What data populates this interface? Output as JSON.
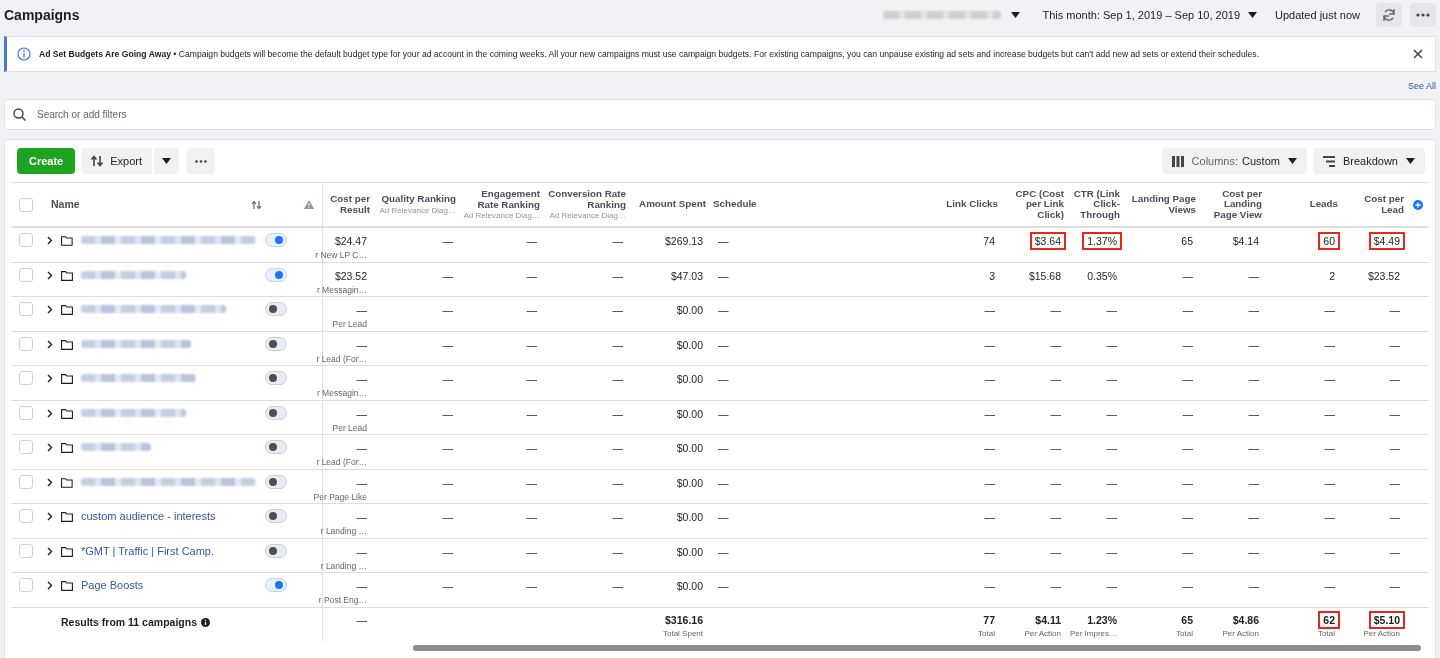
{
  "header": {
    "title": "Campaigns",
    "account": {
      "kind": "redacted"
    },
    "date_range": "This month: Sep 1, 2019 – Sep 10, 2019",
    "updated": "Updated just now"
  },
  "banner": {
    "text": "**Ad Set Budgets Are Going Away** • Campaign budgets will become the default budget type for your ad account in the coming weeks. All your new campaigns must use campaign budgets. For existing campaigns, you can unpause existing ad sets and increase budgets but can't add new ad sets or extend their schedules."
  },
  "see_all": "See All",
  "search": {
    "placeholder": "Search or add filters"
  },
  "toolbar": {
    "create": "Create",
    "export": "Export",
    "columns_label": "Columns:",
    "columns_value": "Custom",
    "breakdown": "Breakdown"
  },
  "table": {
    "name_column": "Name",
    "columns": [
      {
        "label": "Cost per Result"
      },
      {
        "label": "Quality Ranking",
        "sublabel": "Ad Relevance Diag…"
      },
      {
        "label": "Engagement Rate Ranking",
        "sublabel": "Ad Relevance Diag…"
      },
      {
        "label": "Conversion Rate Ranking",
        "sublabel": "Ad Relevance Diag…"
      },
      {
        "label": "Amount Spent"
      },
      {
        "label": "Schedule"
      },
      {
        "label": "Link Clicks"
      },
      {
        "label": "CPC (Cost per Link Click)"
      },
      {
        "label": "CTR (Link Click-Through"
      },
      {
        "label": "Landing Page Views"
      },
      {
        "label": "Cost per Landing Page View"
      },
      {
        "label": "Leads"
      },
      {
        "label": "Cost per Lead"
      }
    ],
    "select_all_checked": false,
    "rows": [
      {
        "name": null,
        "kind": "redacted",
        "checked": false,
        "on": true,
        "cells": [
          {
            "text": "$24.47",
            "sub": "r New LP C…"
          },
          "—",
          "—",
          "—",
          "$269.13",
          "—",
          "74",
          {
            "text": "$3.64",
            "marked": true
          },
          {
            "text": "1.37%",
            "marked": true
          },
          "65",
          "$4.14",
          {
            "text": "60",
            "marked": true
          },
          {
            "text": "$4.49",
            "marked": true
          }
        ]
      },
      {
        "name": null,
        "kind": "redacted",
        "checked": false,
        "on": true,
        "cells": [
          {
            "text": "$23.52",
            "sub": "r Messagin…"
          },
          "—",
          "—",
          "—",
          "$47.03",
          "—",
          "3",
          "$15.68",
          "0.35%",
          "—",
          "—",
          "2",
          "$23.52"
        ]
      },
      {
        "name": null,
        "kind": "redacted",
        "checked": false,
        "on": false,
        "cells": [
          {
            "text": "—",
            "sub": "Per Lead"
          },
          "—",
          "—",
          "—",
          "$0.00",
          "—",
          "—",
          "—",
          "—",
          "—",
          "—",
          "—",
          "—"
        ]
      },
      {
        "name": null,
        "kind": "redacted",
        "checked": false,
        "on": false,
        "cells": [
          {
            "text": "—",
            "sub": "r Lead (For…"
          },
          "—",
          "—",
          "—",
          "$0.00",
          "—",
          "—",
          "—",
          "—",
          "—",
          "—",
          "—",
          "—"
        ]
      },
      {
        "name": null,
        "kind": "redacted",
        "checked": false,
        "on": false,
        "cells": [
          {
            "text": "—",
            "sub": "r Messagin…"
          },
          "—",
          "—",
          "—",
          "$0.00",
          "—",
          "—",
          "—",
          "—",
          "—",
          "—",
          "—",
          "—"
        ]
      },
      {
        "name": null,
        "kind": "redacted",
        "checked": false,
        "on": false,
        "cells": [
          {
            "text": "—",
            "sub": "Per Lead"
          },
          "—",
          "—",
          "—",
          "$0.00",
          "—",
          "—",
          "—",
          "—",
          "—",
          "—",
          "—",
          "—"
        ]
      },
      {
        "name": null,
        "kind": "redacted",
        "checked": false,
        "on": false,
        "cells": [
          {
            "text": "—",
            "sub": "r Lead (For…"
          },
          "—",
          "—",
          "—",
          "$0.00",
          "—",
          "—",
          "—",
          "—",
          "—",
          "—",
          "—",
          "—"
        ]
      },
      {
        "name": null,
        "kind": "redacted",
        "checked": false,
        "on": false,
        "cells": [
          {
            "text": "—",
            "sub": "Per Page Like"
          },
          "—",
          "—",
          "—",
          "$0.00",
          "—",
          "—",
          "—",
          "—",
          "—",
          "—",
          "—",
          "—"
        ]
      },
      {
        "name": "custom audience - interests",
        "kind": "named",
        "checked": false,
        "on": false,
        "cells": [
          {
            "text": "—",
            "sub": "r Landing …"
          },
          "—",
          "—",
          "—",
          "$0.00",
          "—",
          "—",
          "—",
          "—",
          "—",
          "—",
          "—",
          "—"
        ]
      },
      {
        "name": "*GMT | Traffic | First Camp.",
        "kind": "named",
        "checked": false,
        "on": false,
        "cells": [
          {
            "text": "—",
            "sub": "r Landing …"
          },
          "—",
          "—",
          "—",
          "$0.00",
          "—",
          "—",
          "—",
          "—",
          "—",
          "—",
          "—",
          "—"
        ]
      },
      {
        "name": "Page Boosts",
        "kind": "named",
        "checked": false,
        "on": true,
        "cells": [
          {
            "text": "—",
            "sub": "r Post Eng…"
          },
          "—",
          "—",
          "—",
          "$0.00",
          "—",
          "—",
          "—",
          "—",
          "—",
          "—",
          "—",
          "—"
        ]
      }
    ],
    "totals": {
      "label": "Results from 11 campaigns",
      "cells": [
        "—",
        null,
        null,
        null,
        {
          "text": "$316.16",
          "sub": "Total Spent"
        },
        null,
        {
          "text": "77",
          "sub": "Total"
        },
        {
          "text": "$4.11",
          "sub": "Per Action"
        },
        {
          "text": "1.23%",
          "sub": "Per Impres…"
        },
        {
          "text": "65",
          "sub": "Total"
        },
        {
          "text": "$4.86",
          "sub": "Per Action"
        },
        {
          "text": "62",
          "sub": "Total",
          "marked": true
        },
        {
          "text": "$5.10",
          "sub": "Per Action",
          "marked": true
        }
      ]
    }
  }
}
